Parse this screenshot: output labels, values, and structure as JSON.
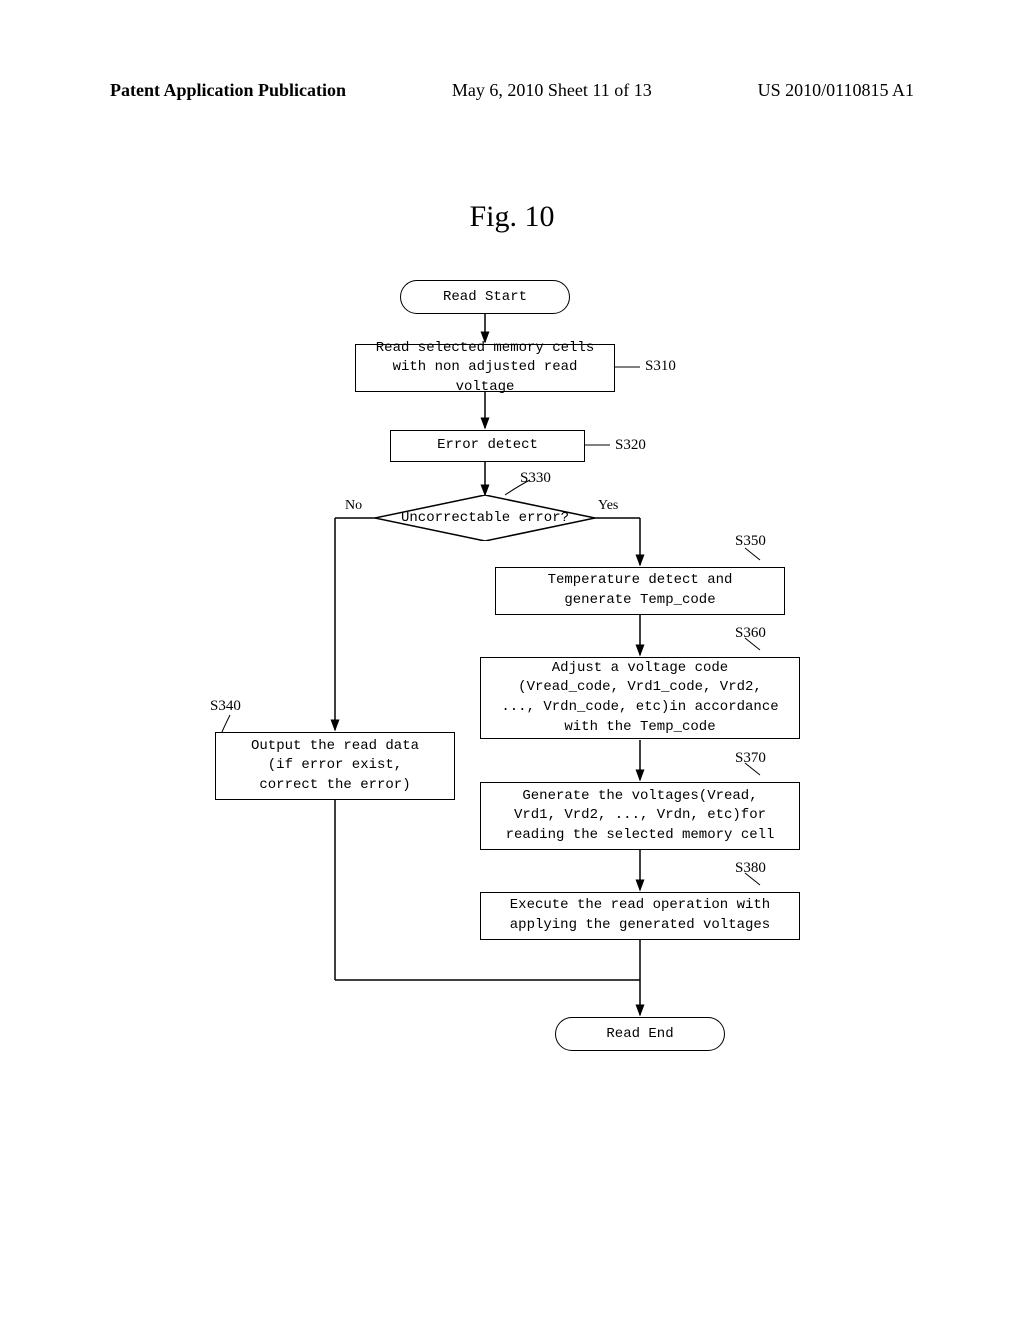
{
  "header": {
    "left": "Patent Application Publication",
    "mid": "May 6, 2010  Sheet 11 of 13",
    "right": "US 2010/0110815 A1"
  },
  "figure_title": "Fig.  10",
  "flow": {
    "start": "Read Start",
    "end": "Read End",
    "s310": {
      "label": "S310",
      "text": "Read selected memory cells\nwith non adjusted read voltage"
    },
    "s320": {
      "label": "S320",
      "text": "Error detect"
    },
    "s330": {
      "label": "S330",
      "text": "Uncorrectable error?",
      "no": "No",
      "yes": "Yes"
    },
    "s340": {
      "label": "S340",
      "text": "Output the read data\n(if error exist,\ncorrect the error)"
    },
    "s350": {
      "label": "S350",
      "text": "Temperature detect and\ngenerate Temp_code"
    },
    "s360": {
      "label": "S360",
      "text": "Adjust a voltage code\n(Vread_code, Vrd1_code, Vrd2,\n..., Vrdn_code, etc)in accordance\nwith the Temp_code"
    },
    "s370": {
      "label": "S370",
      "text": "Generate the voltages(Vread,\nVrd1, Vrd2, ..., Vrdn, etc)for\nreading the selected memory cell"
    },
    "s380": {
      "label": "S380",
      "text": "Execute the read operation with\napplying the generated voltages"
    }
  }
}
